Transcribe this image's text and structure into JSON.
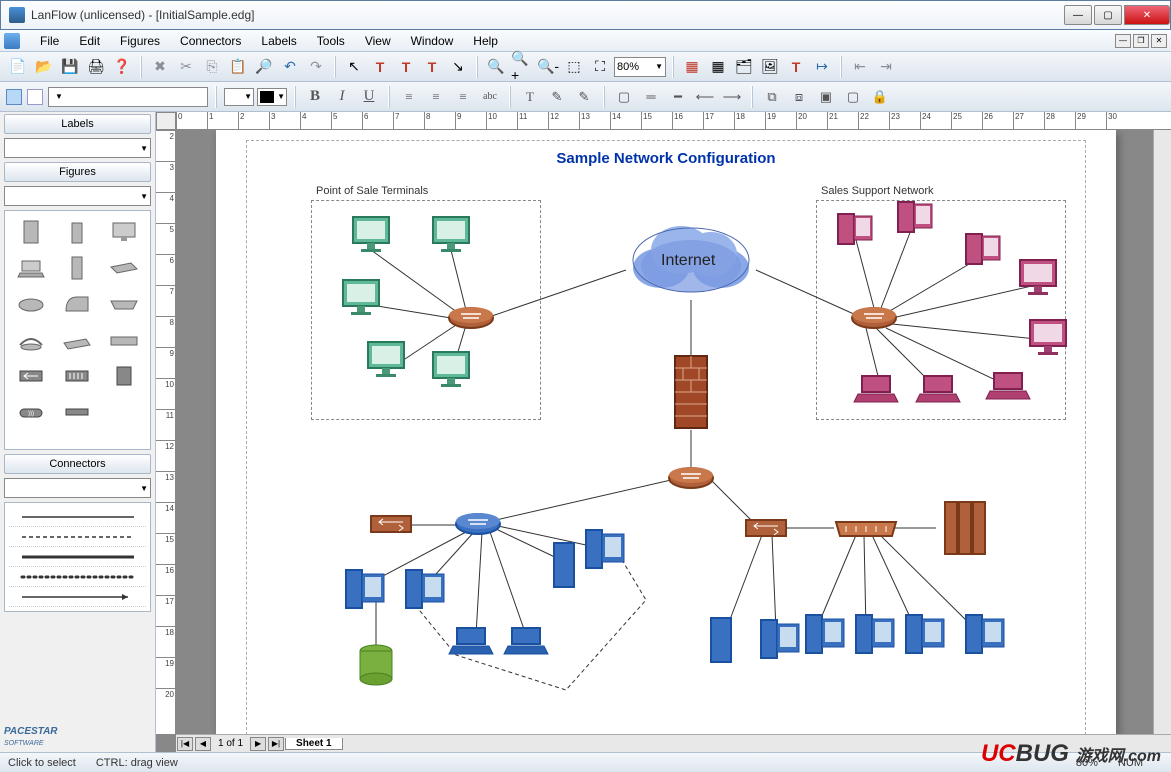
{
  "title": "LanFlow (unlicensed) - [InitialSample.edg]",
  "menus": [
    "File",
    "Edit",
    "Figures",
    "Connectors",
    "Labels",
    "Tools",
    "View",
    "Window",
    "Help"
  ],
  "zoom": "80%",
  "sidebar": {
    "labels_header": "Labels",
    "figures_header": "Figures",
    "connectors_header": "Connectors",
    "logo": "PACESTAR",
    "logo_sub": "SOFTWARE"
  },
  "ruler_h": [
    0,
    1,
    2,
    3,
    4,
    5,
    6,
    7,
    8,
    9,
    10,
    11,
    12,
    13,
    14,
    15,
    16,
    17,
    18,
    19,
    20,
    21,
    22,
    23,
    24,
    25,
    26,
    27,
    28,
    29,
    30
  ],
  "ruler_v": [
    2,
    3,
    4,
    5,
    6,
    7,
    8,
    9,
    10,
    11,
    12,
    13,
    14,
    15,
    16,
    17,
    18,
    19,
    20
  ],
  "sheet": {
    "nav": "1 of 1",
    "tab": "Sheet 1"
  },
  "status": {
    "hint1": "Click to select",
    "hint2": "CTRL: drag view",
    "zoom": "80%",
    "numlock": "NUM"
  },
  "diagram": {
    "title": "Sample Network Configuration",
    "group1": "Point of Sale Terminals",
    "group2": "Sales Support Network",
    "cloud": "Internet"
  },
  "watermark": {
    "uc": "UC",
    "bug": "BUG",
    "cn": "游戏网",
    "com": ".com"
  }
}
